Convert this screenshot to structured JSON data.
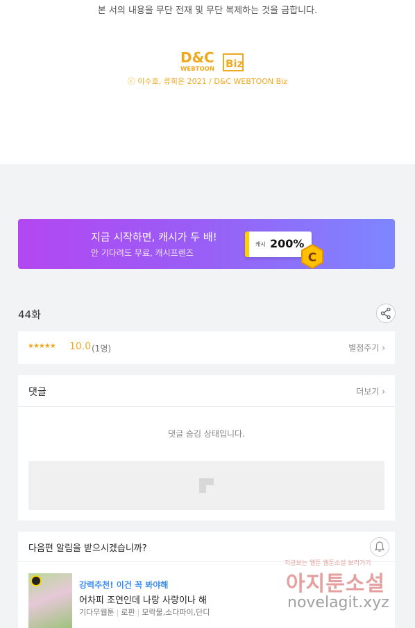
{
  "footer": {
    "notice": "본 서의 내용을 무단 전재 및 무단 복제하는 것을 금합니다.",
    "logo_text": "D&C WEBTOON Biz",
    "copyright": "ⓒ 이수호, 류희온 2021 / D&C WEBTOON Biz"
  },
  "banner": {
    "title": "지금 시작하면, 캐시가 두 배!",
    "subtitle": "안 기다려도 무료, 캐시프렌즈",
    "cash_label": "캐시",
    "cash_value": "200%",
    "coin_letter": "C"
  },
  "episode": {
    "title": "44화",
    "share_icon": "share-icon"
  },
  "rating": {
    "stars": "★★★★★",
    "score": "10.0",
    "raters": "(1명)",
    "rate_link": "별점주기 ›"
  },
  "comments": {
    "title": "댓글",
    "more_link": "더보기 ›",
    "hidden_message": "댓글 숨김 상태입니다."
  },
  "next_episode": {
    "question": "다음편 알림을 받으시겠습니까?",
    "bell_icon": "bell-icon"
  },
  "recommendation": {
    "label": "강력추천! 이건 꼭 봐야해",
    "title": "어차피 조연인데 나랑 사랑이나 해",
    "meta": [
      "기다무웹툰",
      "로판",
      "모락물,소다파이,단디"
    ]
  },
  "watermark": {
    "line1": "지금보는 웹툰 웹툰소설 보러가기",
    "line2": "아지툰소설",
    "line3": "novelagit.xyz"
  },
  "colors": {
    "accent_orange": "#f0a81e",
    "banner_purple": "#b347f2",
    "link_blue": "#3b8df0"
  }
}
